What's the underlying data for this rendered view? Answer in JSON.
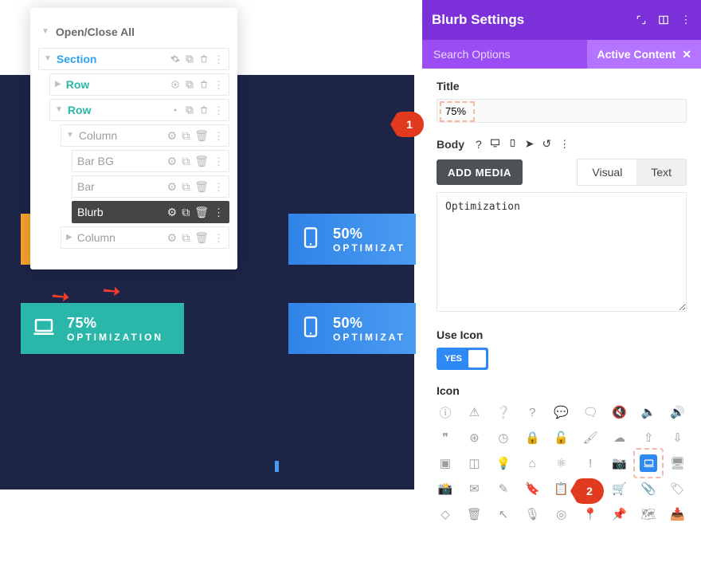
{
  "layers": {
    "open_close": "Open/Close All",
    "section": "Section",
    "row1": "Row",
    "row2": "Row",
    "col1": "Column",
    "barbg": "Bar BG",
    "bar": "Bar",
    "blurb": "Blurb",
    "col2": "Column"
  },
  "preview": {
    "c1_pct": "50%",
    "c1_sub": "OPTIMIZAT",
    "c2_pct": "75%",
    "c2_sub": "OPTIMIZATION",
    "c3_pct": "50%",
    "c3_sub": "OPTIMIZAT"
  },
  "panel": {
    "title": "Blurb Settings",
    "search_ph": "Search Options",
    "chip": "Active Content",
    "field_title": "Title",
    "title_value": "75%",
    "field_body": "Body",
    "add_media": "ADD MEDIA",
    "tab_visual": "Visual",
    "tab_text": "Text",
    "body_value": "Optimization",
    "use_icon": "Use Icon",
    "toggle_yes": "YES",
    "icon_label": "Icon"
  },
  "badges": {
    "one": "1",
    "two": "2"
  }
}
